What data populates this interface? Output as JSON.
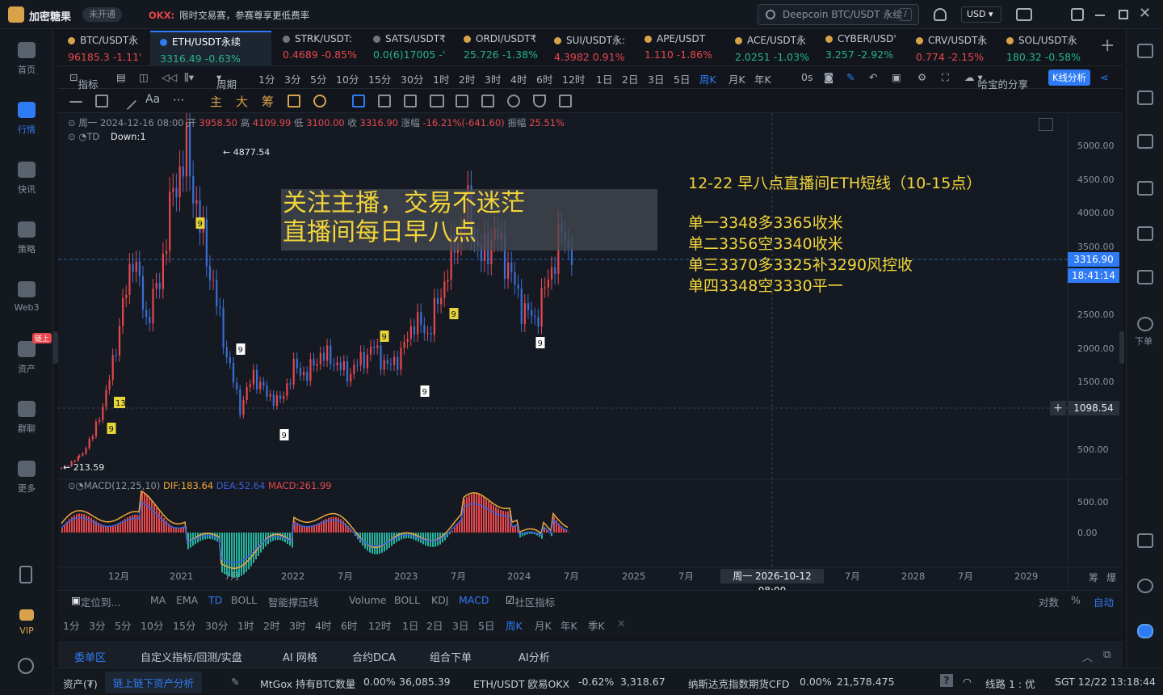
{
  "app": {
    "title": "加密糖果",
    "status": "未开通",
    "notice_brand": "OKX:",
    "notice": "限时交易赛，参赛尊享更低费率"
  },
  "search": {
    "placeholder": "Deepcoin BTC/USDT 永续",
    "shortcut": "/"
  },
  "currency": "USD",
  "leftnav": [
    {
      "label": "首页",
      "icon": "home-icon"
    },
    {
      "label": "行情",
      "icon": "chart-bars-icon",
      "active": true
    },
    {
      "label": "快讯",
      "icon": "news-icon"
    },
    {
      "label": "策略",
      "icon": "robot-icon"
    },
    {
      "label": "Web3",
      "icon": "web3-icon"
    },
    {
      "label": "资产",
      "icon": "wallet-icon",
      "badge": "链上"
    },
    {
      "label": "群聊",
      "icon": "chat-icon"
    },
    {
      "label": "更多",
      "icon": "grid-icon"
    }
  ],
  "vip_label": "VIP",
  "tickers": [
    {
      "name": "BTC/USDT永",
      "price": "96185.3",
      "change": "-1.11'"
    },
    {
      "name": "ETH/USDT永续",
      "price": "3316.49",
      "change": "-0.63%",
      "selected": true
    },
    {
      "name": "STRK/USDT:",
      "price": "0.4689",
      "change": "-0.85%"
    },
    {
      "name": "SATS/USDT₹",
      "price": "0.0(6)17005",
      "change": "-'"
    },
    {
      "name": "ORDI/USDT₹",
      "price": "25.726",
      "change": "-1.38%"
    },
    {
      "name": "SUI/USDT永:",
      "price": "4.3982",
      "change": "0.91%"
    },
    {
      "name": "APE/USDT",
      "price": "1.110",
      "change": "-1.86%"
    },
    {
      "name": "ACE/USDT永",
      "price": "2.0251",
      "change": "-1.03%"
    },
    {
      "name": "CYBER/USD'",
      "price": "3.257",
      "change": "-2.92%"
    },
    {
      "name": "CRV/USDT永",
      "price": "0.774",
      "change": "-2.15%"
    },
    {
      "name": "SOL/USDT永",
      "price": "180.32",
      "change": "-0.58%"
    }
  ],
  "toolbar": {
    "indicator": "指标",
    "period": "周期",
    "timeframes": [
      "1分",
      "3分",
      "5分",
      "10分",
      "15分",
      "30分",
      "1时",
      "2时",
      "3时",
      "4时",
      "6时",
      "12时",
      "1日",
      "2日",
      "3日",
      "5日",
      "周K",
      "月K",
      "年K"
    ],
    "active_tf": "周K",
    "seconds": "0s",
    "share": "哈宝的分享",
    "kline_btn": "K线分析"
  },
  "drawbar": {
    "text_tool": "Aa",
    "more": "···",
    "labels": [
      "主",
      "大",
      "筹"
    ]
  },
  "chart": {
    "ohlc_prefix": "周一 2024-12-16 08:00",
    "open_label": "开",
    "open": "3958.50",
    "high_label": "高",
    "high": "4109.99",
    "low_label": "低",
    "low": "3100.00",
    "close_label": "收",
    "close": "3316.90",
    "chg_label": "涨幅",
    "chg": "-16.21%(-641.60)",
    "amp_label": "振幅",
    "amp": "25.51%",
    "td_label": "TD",
    "td_value": "Down:1",
    "max_label": "4877.54",
    "min_label": "213.59",
    "banner_line1": "关注主播，交易不迷茫",
    "banner_line2": "直播间每日早八点",
    "note_title": "12-22 早八点直播间ETH短线（10-15点）",
    "note_lines": [
      "单一3348多3365收米",
      "单二3356空3340收米",
      "单三3370多3325补3290风控收",
      "单四3348空3330平一"
    ],
    "price_tag": "3316.90",
    "countdown": "18:41:14",
    "cross_tag": "1098.54",
    "macd_label": "MACD(12,25,10)",
    "dif": "DIF:183.64",
    "dea": "DEA:52.64",
    "macd": "MACD:261.99",
    "crosshair_date": "周一 2026-10-12 08:00",
    "bottom_right": [
      "筹",
      "爆"
    ]
  },
  "chart_data": {
    "type": "candlestick",
    "title": "ETH/USDT永续",
    "y_axis": [
      5000,
      4500,
      4000,
      3500,
      2500,
      2000,
      1500,
      500
    ],
    "macd_axis": [
      500,
      0
    ],
    "x_axis": [
      "12月",
      "2021",
      "7月",
      "2022",
      "7月",
      "2023",
      "7月",
      "2024",
      "7月",
      "2025",
      "7月",
      "2026",
      "7月",
      "2028",
      "7月",
      "2029"
    ],
    "price_path": [
      [
        0,
        214
      ],
      [
        8,
        380
      ],
      [
        14,
        700
      ],
      [
        20,
        1300
      ],
      [
        26,
        2300
      ],
      [
        32,
        3400
      ],
      [
        38,
        2400
      ],
      [
        44,
        3000
      ],
      [
        50,
        4300
      ],
      [
        56,
        4877
      ],
      [
        62,
        3800
      ],
      [
        68,
        2900
      ],
      [
        74,
        1900
      ],
      [
        80,
        1100
      ],
      [
        86,
        1600
      ],
      [
        92,
        1300
      ],
      [
        98,
        1200
      ],
      [
        104,
        1700
      ],
      [
        110,
        1600
      ],
      [
        116,
        1900
      ],
      [
        122,
        1800
      ],
      [
        128,
        1600
      ],
      [
        134,
        1800
      ],
      [
        140,
        2000
      ],
      [
        146,
        1700
      ],
      [
        152,
        1900
      ],
      [
        158,
        2400
      ],
      [
        164,
        2200
      ],
      [
        170,
        2800
      ],
      [
        176,
        3500
      ],
      [
        182,
        4000
      ],
      [
        188,
        3300
      ],
      [
        194,
        3700
      ],
      [
        200,
        3200
      ],
      [
        206,
        2600
      ],
      [
        212,
        2400
      ],
      [
        218,
        3000
      ],
      [
        224,
        3700
      ],
      [
        230,
        3317
      ]
    ],
    "td_marks": [
      {
        "label": "9",
        "color": "#e6d43a"
      },
      {
        "label": "13",
        "color": "#e6d43a"
      },
      {
        "label": "9",
        "color": "#e6d43a"
      },
      {
        "label": "9",
        "color": "#ffffff"
      },
      {
        "label": "9",
        "color": "#ffffff"
      },
      {
        "label": "9",
        "color": "#e6d43a"
      },
      {
        "label": "9",
        "color": "#ffffff"
      },
      {
        "label": "9",
        "color": "#e6d43a"
      },
      {
        "label": "9",
        "color": "#ffffff"
      }
    ]
  },
  "indicators": {
    "goto": "定位到...",
    "main": [
      "MA",
      "EMA",
      "TD",
      "BOLL",
      "智能撑压线"
    ],
    "main_active": "TD",
    "sub": [
      "Volume",
      "BOLL",
      "KDJ",
      "MACD"
    ],
    "sub_active": "MACD",
    "community": "社区指标",
    "right": [
      "对数",
      "%",
      "自动"
    ],
    "timeframes": [
      "1分",
      "3分",
      "5分",
      "10分",
      "15分",
      "30分",
      "1时",
      "2时",
      "3时",
      "4时",
      "6时",
      "12时",
      "1日",
      "2日",
      "3日",
      "5日",
      "周K",
      "月K",
      "年K",
      "季K"
    ],
    "active_tf": "周K"
  },
  "panel_tabs": [
    "委单区",
    "自定义指标/回测/实盘",
    "AI 网格",
    "合约DCA",
    "组合下单",
    "AI分析"
  ],
  "status": {
    "asset": "资产(₮)",
    "asset_link": "链上链下资产分析",
    "t1_name": "MtGox 持有BTC数量",
    "t1_chg": "0.00%",
    "t1_val": "36,085.39",
    "t2_name": "ETH/USDT 欧易OKX",
    "t2_chg": "-0.62%",
    "t2_val": "3,318.67",
    "t3_name": "纳斯达克指数期货CFD",
    "t3_chg": "0.00%",
    "t3_val": "21,578.475",
    "line": "线路 1 : 优",
    "time": "SGT 12/22 13:18:44"
  },
  "right_order": "下单"
}
